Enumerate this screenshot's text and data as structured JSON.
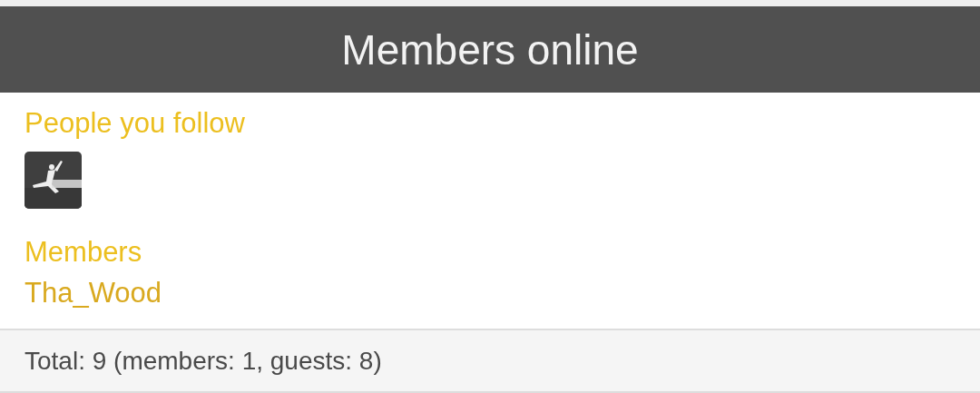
{
  "header": {
    "title": "Members online"
  },
  "following": {
    "heading": "People you follow"
  },
  "members": {
    "heading": "Members",
    "names": [
      "Tha_Wood"
    ]
  },
  "footer": {
    "total": "Total: 9 (members: 1, guests: 8)"
  }
}
